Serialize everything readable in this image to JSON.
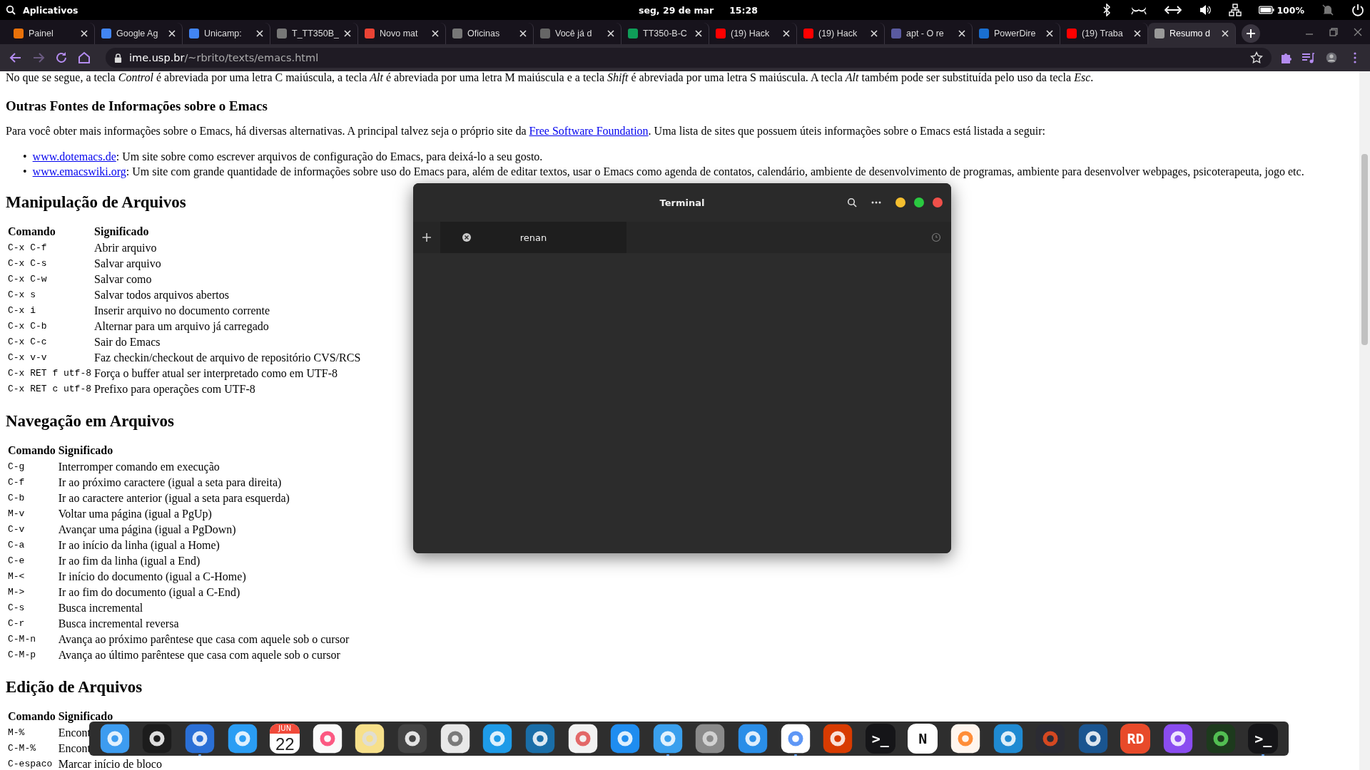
{
  "top_bar": {
    "apps_label": "Aplicativos",
    "date": "seg, 29 de mar",
    "time": "15:28",
    "battery": "100%"
  },
  "tabs": [
    {
      "title": "Painel",
      "selected": false
    },
    {
      "title": "Google Ag",
      "selected": false
    },
    {
      "title": "Unicamp:",
      "selected": false
    },
    {
      "title": "T_TT350B_",
      "selected": false
    },
    {
      "title": "Novo mat",
      "selected": false
    },
    {
      "title": "Oficinas",
      "selected": false
    },
    {
      "title": "Você já d",
      "selected": false
    },
    {
      "title": "TT350-B-C",
      "selected": false
    },
    {
      "title": "(19) Hack",
      "selected": false
    },
    {
      "title": "(19) Hack",
      "selected": false
    },
    {
      "title": "apt - O re",
      "selected": false
    },
    {
      "title": "PowerDire",
      "selected": false
    },
    {
      "title": "(19) Traba",
      "selected": false
    },
    {
      "title": "Resumo d",
      "selected": true
    }
  ],
  "address_bar": {
    "host": "ime.usp.br",
    "path": "/~rbrito/texts/emacs.html"
  },
  "page": [
    {
      "kind": "paragraph",
      "text": "No que se segue, a tecla *Control* é abreviada por uma letra C maiúscula, a tecla *Alt* é abreviada por uma letra M maiúscula e a tecla *Shift* é abreviada por uma letra S maiúscula. A tecla *Alt* também pode ser substituída pelo uso da tecla *Esc*."
    },
    {
      "kind": "heading3",
      "text": "Outras Fontes de Informações sobre o Emacs"
    },
    {
      "kind": "link_paragraph",
      "before": "Para você obter mais informações sobre o Emacs, há diversas alternativas. A principal talvez seja o próprio site da",
      "link": "Free Software Foundation",
      "after": ". Uma lista de sites que possuem úteis informações sobre o Emacs está listada a seguir:"
    },
    {
      "kind": "list",
      "items": [
        {
          "marker": "•",
          "link": "www.dotemacs.de",
          "text": ": Um site sobre como escrever arquivos de configuração do Emacs, para deixá-lo a seu gosto."
        },
        {
          "marker": "•",
          "link": "www.emacswiki.org",
          "text": ": Um site com grande quantidade de informações sobre uso do Emacs para, além de editar textos, usar o Emacs como agenda de contatos, calendário, ambiente de desenvolvimento de programas, ambiente para desenvolver webpages, psicoterapeuta, jogo etc."
        }
      ]
    },
    {
      "kind": "heading2",
      "text": "Manipulação de Arquivos"
    },
    {
      "kind": "table",
      "columns": [
        "Comando",
        "Significado"
      ],
      "rows": [
        [
          "C-x C-f",
          "Abrir arquivo"
        ],
        [
          "C-x C-s",
          "Salvar arquivo"
        ],
        [
          "C-x C-w",
          "Salvar como"
        ],
        [
          "C-x s",
          "Salvar todos arquivos abertos"
        ],
        [
          "C-x i",
          "Inserir arquivo no documento corrente"
        ],
        [
          "C-x C-b",
          "Alternar para um arquivo já carregado"
        ],
        [
          "C-x C-c",
          "Sair do Emacs"
        ],
        [
          "C-x v-v",
          "Faz checkin/checkout de arquivo de repositório CVS/RCS"
        ],
        [
          "C-x RET f utf-8",
          "Força o buffer atual ser interpretado como em UTF-8"
        ],
        [
          "C-x RET c utf-8",
          "Prefixo para operações com UTF-8"
        ]
      ]
    },
    {
      "kind": "heading2",
      "text": "Navegação em Arquivos"
    },
    {
      "kind": "table",
      "columns": [
        "Comando",
        "Significado"
      ],
      "rows": [
        [
          "C-g",
          "Interromper comando em execução"
        ],
        [
          "C-f",
          "Ir ao próximo caractere (igual a seta para direita)"
        ],
        [
          "C-b",
          "Ir ao caractere anterior (igual a seta para esquerda)"
        ],
        [
          "M-v",
          "Voltar uma página (igual a PgUp)"
        ],
        [
          "C-v",
          "Avançar uma página (igual a PgDown)"
        ],
        [
          "C-a",
          "Ir ao início da linha (igual a Home)"
        ],
        [
          "C-e",
          "Ir ao fim da linha (igual a End)"
        ],
        [
          "M-<",
          "Ir início do documento (igual a C-Home)"
        ],
        [
          "M->",
          "Ir ao fim do documento (igual a C-End)"
        ],
        [
          "C-s",
          "Busca incremental"
        ],
        [
          "C-r",
          "Busca incremental reversa"
        ],
        [
          "C-M-n",
          "Avança ao próximo parêntese que casa com aquele sob o cursor"
        ],
        [
          "C-M-p",
          "Avança ao último parêntese que casa com aquele sob o cursor"
        ]
      ]
    },
    {
      "kind": "heading2",
      "text": "Edição de Arquivos"
    },
    {
      "kind": "table",
      "columns": [
        "Comando",
        "Significado"
      ],
      "rows": [
        [
          "M-%",
          "Encont"
        ],
        [
          "C-M-%",
          "Encont"
        ],
        [
          "C-espaco",
          "Marcar início de bloco"
        ]
      ]
    }
  ],
  "terminal": {
    "title": "Terminal",
    "tab": "renan"
  },
  "dock": [
    {
      "kind": "app",
      "running": false
    },
    {
      "kind": "app",
      "running": false
    },
    {
      "kind": "app",
      "running": true
    },
    {
      "kind": "app",
      "running": false
    },
    {
      "kind": "calendar",
      "month": "JUN",
      "day": "22",
      "running": false
    },
    {
      "kind": "app",
      "running": false
    },
    {
      "kind": "app",
      "running": false
    },
    {
      "kind": "app",
      "running": false
    },
    {
      "kind": "app",
      "running": false
    },
    {
      "kind": "app",
      "running": false
    },
    {
      "kind": "app",
      "running": false
    },
    {
      "kind": "app",
      "running": false
    },
    {
      "kind": "app",
      "running": false
    },
    {
      "kind": "app",
      "running": true
    },
    {
      "kind": "app",
      "running": false
    },
    {
      "kind": "app",
      "running": false
    },
    {
      "kind": "app",
      "running": true
    },
    {
      "kind": "app",
      "running": false
    },
    {
      "kind": "glyph",
      "label": ">_",
      "running": false
    },
    {
      "kind": "glyph",
      "label": "N",
      "running": false
    },
    {
      "kind": "app",
      "running": false
    },
    {
      "kind": "app",
      "running": false
    },
    {
      "kind": "app",
      "running": false
    },
    {
      "kind": "app",
      "running": false
    },
    {
      "kind": "glyph",
      "label": "RD",
      "running": false
    },
    {
      "kind": "app",
      "running": false
    },
    {
      "kind": "app",
      "running": false
    },
    {
      "kind": "glyph",
      "label": ">_",
      "running": true
    }
  ]
}
